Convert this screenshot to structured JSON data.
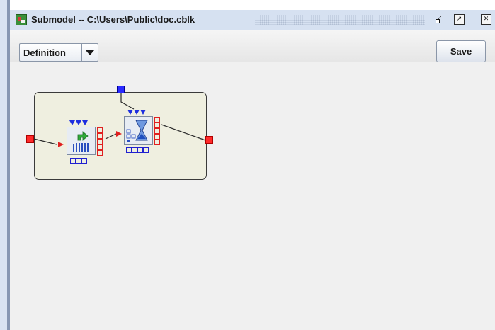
{
  "window": {
    "title": "Submodel -- C:\\Users\\Public\\doc.cblk",
    "controls": {
      "minimize": "minimize",
      "maximize": "maximize",
      "close": "close"
    }
  },
  "toolbar": {
    "view_selector": {
      "selected": "Definition"
    },
    "save_label": "Save"
  },
  "diagram": {
    "blocks": [
      {
        "icon": "activity-block-icon"
      },
      {
        "icon": "hourglass-queue-block-icon"
      }
    ],
    "colors": {
      "item_connector": "#e02020",
      "value_connector": "#2020d0",
      "submodel_fill": "#efefe0"
    }
  }
}
